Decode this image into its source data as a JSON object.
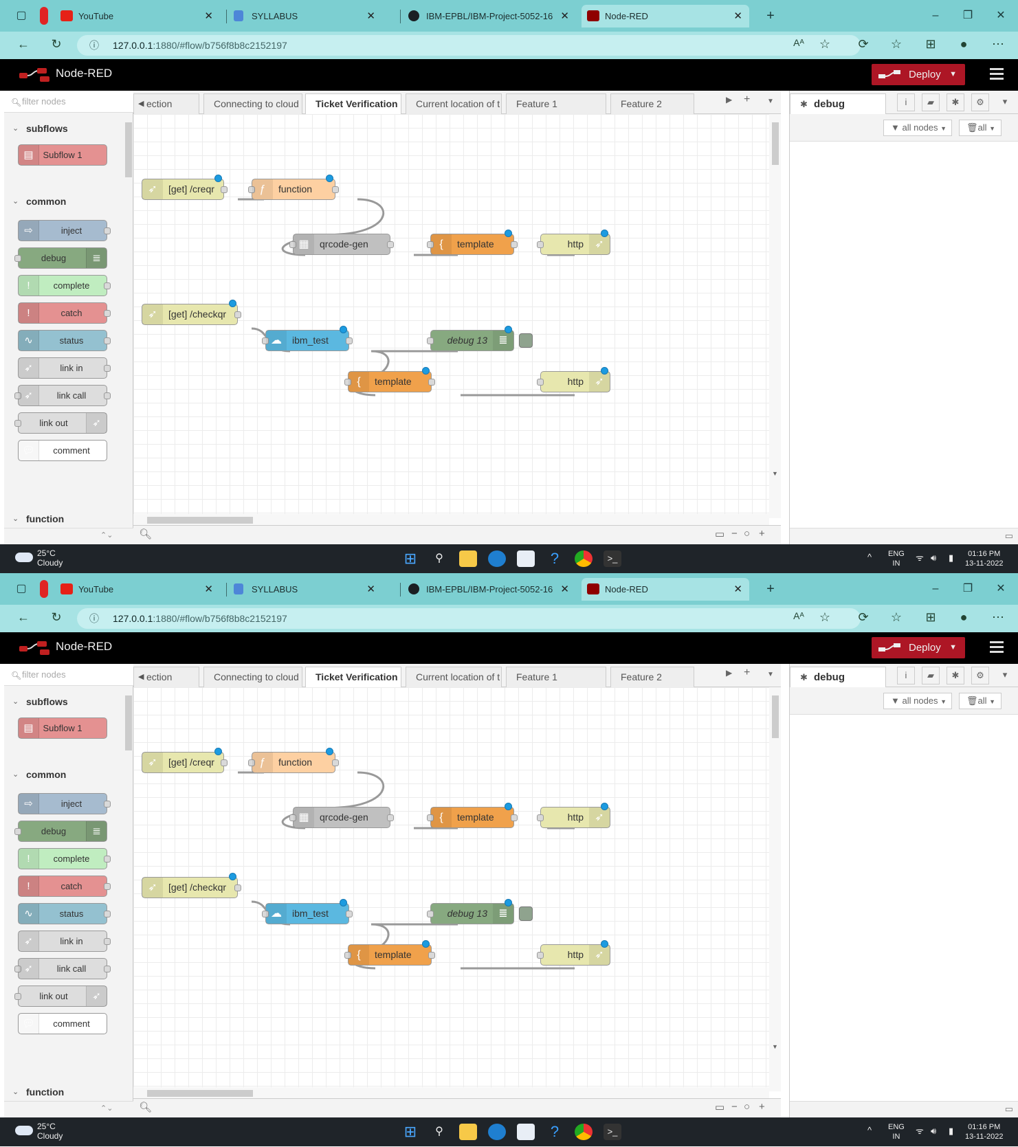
{
  "browser": {
    "tabs": [
      {
        "title": "YouTube"
      },
      {
        "title": "SYLLABUS"
      },
      {
        "title": "IBM-EPBL/IBM-Project-5052-16"
      },
      {
        "title": "Node-RED"
      }
    ],
    "url_host": "127.0.0.1",
    "url_rest": ":1880/#flow/b756f8b8c2152197"
  },
  "app": {
    "title": "Node-RED",
    "deploy_label": "Deploy"
  },
  "palette": {
    "filter_placeholder": "filter nodes",
    "categories": {
      "subflows": "subflows",
      "common": "common",
      "function": "function"
    },
    "subflow_node": "Subflow 1",
    "common_nodes": [
      "inject",
      "debug",
      "complete",
      "catch",
      "status",
      "link in",
      "link call",
      "link out",
      "comment"
    ]
  },
  "workspace": {
    "tabs": [
      "ection",
      "Connecting to cloud",
      "Ticket Verification",
      "Current location of t",
      "Feature 1",
      "Feature 2"
    ],
    "active_tab": "Ticket Verification"
  },
  "flow": {
    "nodes": {
      "get_creqr": "[get] /creqr",
      "function": "function",
      "qrcode_gen": "qrcode-gen",
      "template1": "template",
      "http1": "http",
      "get_checkqr": "[get] /checkqr",
      "ibm_test": "ibm_test",
      "debug13": "debug 13",
      "template2": "template",
      "http2": "http"
    }
  },
  "sidebar": {
    "tab_label": "debug",
    "filter_label": "all nodes",
    "clear_label": "all"
  },
  "taskbar": {
    "temp": "25°C",
    "condition": "Cloudy",
    "lang": "ENG",
    "region": "IN",
    "time": "01:16 PM",
    "date": "13-11-2022"
  },
  "colors": {
    "deploy": "#ad1625",
    "http_in": "#e7e7ae",
    "function": "#fdd0a2",
    "template": "#f0a14b",
    "qrcode": "#c0c0c0",
    "ibm": "#5bb8e0",
    "debug": "#87a980",
    "status_dot": "#1c9be0"
  }
}
